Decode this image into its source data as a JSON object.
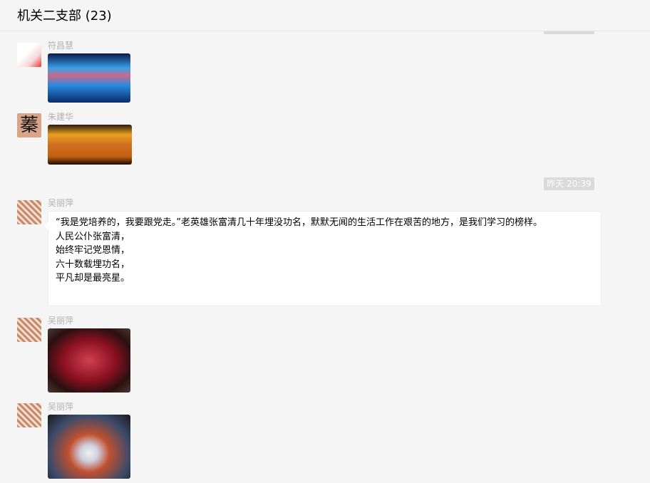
{
  "header": {
    "title": "机关二支部 (23)"
  },
  "timestamps": [
    "昨天 20:39"
  ],
  "messages": [
    {
      "sender": "符昌慧",
      "type": "image"
    },
    {
      "sender": "朱建华",
      "type": "image"
    },
    {
      "sender": "吴丽萍",
      "type": "text",
      "lines": [
        "“我是党培养的，我要跟党走。”老英雄张富清几十年埋没功名，默默无闻的生活工作在艰苦的地方，是我们学习的榜样。",
        "人民公仆张富清，",
        "始终牢记党恩情，",
        "六十数载埋功名，",
        "平凡却是最亮星。"
      ]
    },
    {
      "sender": "吴丽萍",
      "type": "image"
    },
    {
      "sender": "吴丽萍",
      "type": "image"
    }
  ]
}
